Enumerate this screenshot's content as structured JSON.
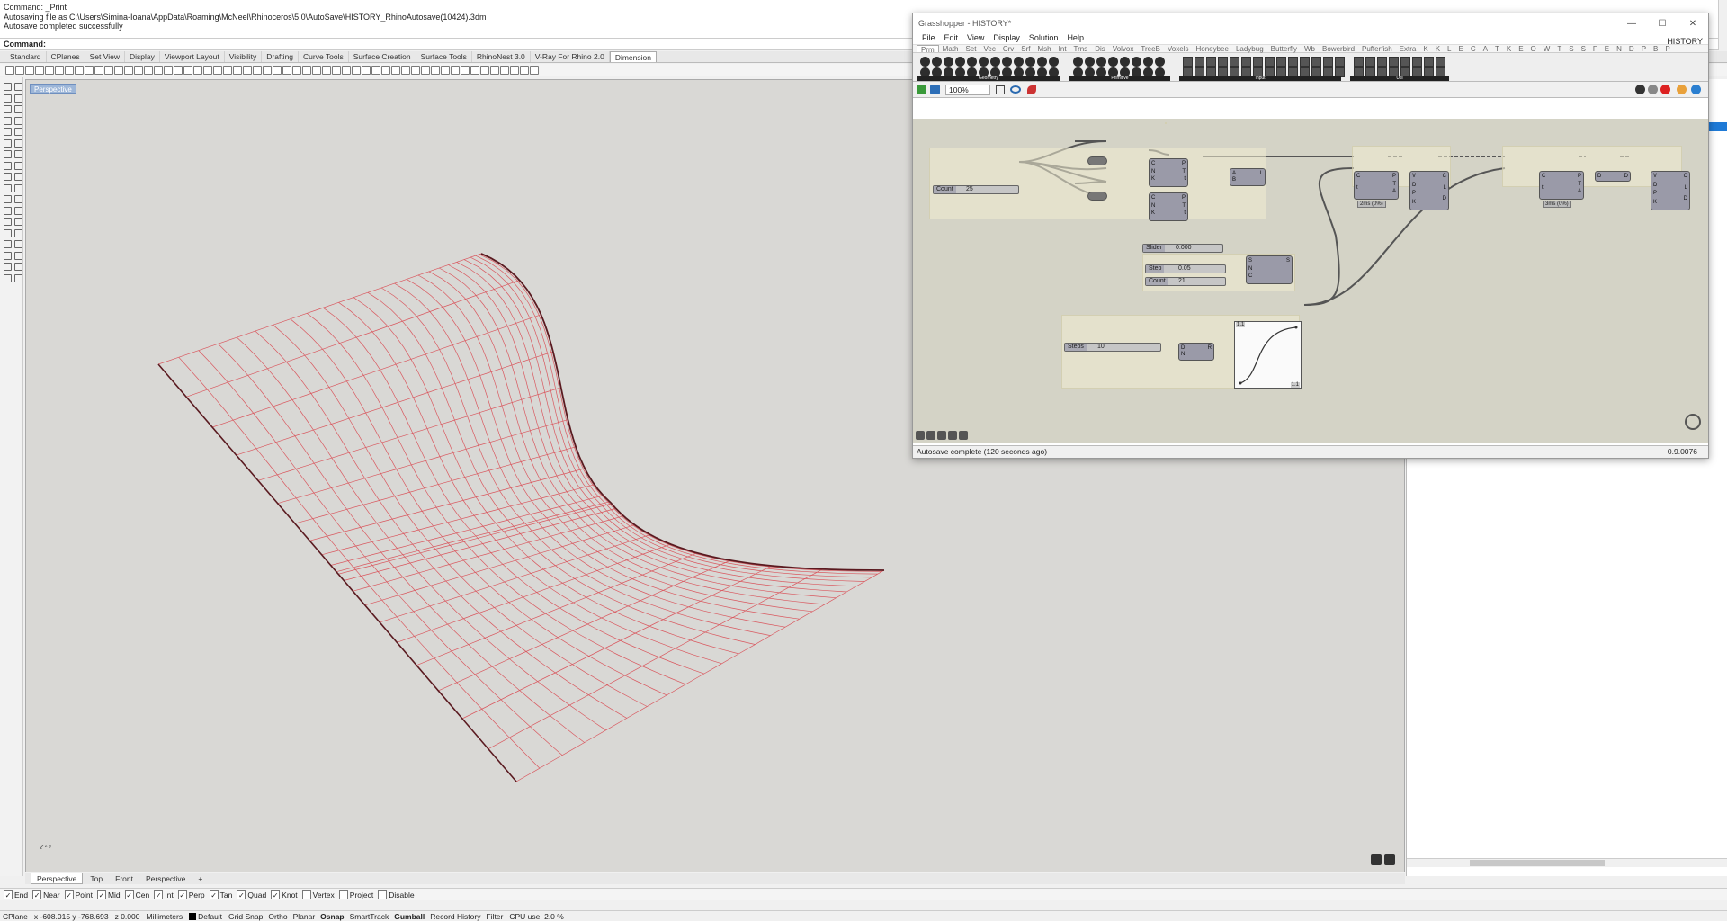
{
  "command_history": [
    "Command: _Print",
    "Autosaving file as C:\\Users\\Simina-Ioana\\AppData\\Roaming\\McNeel\\Rhinoceros\\5.0\\AutoSave\\HISTORY_RhinoAutosave(10424).3dm",
    "Autosave completed successfully"
  ],
  "command_prompt": "Command:",
  "toolbar_tabs": [
    "Standard",
    "CPlanes",
    "Set View",
    "Display",
    "Viewport Layout",
    "Visibility",
    "Drafting",
    "Curve Tools",
    "Surface Creation",
    "Surface Tools",
    "RhinoNest 3.0",
    "V-Ray For Rhino 2.0",
    "Dimension"
  ],
  "active_toolbar_tab": "Dimension",
  "viewport": {
    "title": "Perspective",
    "background": "#d9d8d5",
    "curve_color": "#d9585f",
    "edge_color": "#5a1a20"
  },
  "viewport_tabs": [
    "Perspective",
    "Top",
    "Front",
    "Perspective",
    "+"
  ],
  "active_viewport_tab": "Perspective",
  "osnaps": [
    {
      "label": "End",
      "checked": true
    },
    {
      "label": "Near",
      "checked": true
    },
    {
      "label": "Point",
      "checked": true
    },
    {
      "label": "Mid",
      "checked": true
    },
    {
      "label": "Cen",
      "checked": true
    },
    {
      "label": "Int",
      "checked": true
    },
    {
      "label": "Perp",
      "checked": true
    },
    {
      "label": "Tan",
      "checked": true
    },
    {
      "label": "Quad",
      "checked": true
    },
    {
      "label": "Knot",
      "checked": true
    },
    {
      "label": "Vertex",
      "checked": false
    },
    {
      "label": "Project",
      "checked": false
    },
    {
      "label": "Disable",
      "checked": false
    }
  ],
  "status": {
    "cplane": "CPlane",
    "coords": "x -608.015  y -768.693",
    "z": "z 0.000",
    "units": "Millimeters",
    "layer": "Default",
    "toggles": [
      "Grid Snap",
      "Ortho",
      "Planar",
      "Osnap",
      "SmartTrack",
      "Gumball",
      "Record History",
      "Filter"
    ],
    "bold_toggles": [
      "Osnap",
      "Gumball"
    ],
    "cpu": "CPU use: 2.0 %"
  },
  "grasshopper": {
    "window_title": "Grasshopper - HISTORY*",
    "menu": [
      "File",
      "Edit",
      "View",
      "Display",
      "Solution",
      "Help"
    ],
    "document_name": "HISTORY",
    "tabs": [
      "Prm",
      "Math",
      "Set",
      "Vec",
      "Crv",
      "Srf",
      "Msh",
      "Int",
      "Trns",
      "Dis",
      "Volvox",
      "TreeB",
      "Voxels",
      "Honeybee",
      "Ladybug",
      "Butterfly",
      "Wb",
      "Bowerbird",
      "Pufferfish",
      "Extra",
      "K",
      "K",
      "L",
      "E",
      "C",
      "A",
      "T",
      "K",
      "E",
      "O",
      "W",
      "T",
      "S",
      "S",
      "F",
      "E",
      "N",
      "D",
      "P",
      "B",
      "P"
    ],
    "active_tab": "Prm",
    "categories": [
      "Geometry",
      "Primitive",
      "Input",
      "Util"
    ],
    "zoom": "100%",
    "status": "Autosave complete (120 seconds ago)",
    "version": "0.9.0076",
    "sliders": [
      {
        "label": "Count",
        "value": "25"
      },
      {
        "label": "Slider",
        "value": "0.000"
      },
      {
        "label": "Step",
        "value": "0.05"
      },
      {
        "label": "Count",
        "value": "21"
      },
      {
        "label": "Steps",
        "value": "10"
      }
    ],
    "timers": [
      "2ms (0%)",
      "3ms (0%)"
    ],
    "node_ports": {
      "divide_a": {
        "in": [
          "C",
          "N",
          "K"
        ],
        "out": [
          "P",
          "T",
          "t"
        ]
      },
      "divide_b": {
        "in": [
          "C",
          "N",
          "K"
        ],
        "out": [
          "P",
          "T",
          "t"
        ]
      },
      "merge": {
        "in": [
          "A",
          "B"
        ],
        "out": [
          "L"
        ]
      },
      "loft_1": {
        "in": [
          "C",
          "t"
        ],
        "out": [
          "P",
          "T",
          "A"
        ]
      },
      "vec_1": {
        "in": [
          "V",
          "D",
          "P",
          "K"
        ],
        "out": [
          "C",
          "L",
          "D"
        ]
      },
      "series": {
        "in": [
          "S",
          "N",
          "C"
        ],
        "out": [
          "S"
        ]
      },
      "range": {
        "in": [
          "D",
          "N"
        ],
        "out": [
          "R"
        ]
      },
      "loft_2": {
        "in": [
          "C",
          "t"
        ],
        "out": [
          "P",
          "T",
          "A"
        ]
      },
      "dup": {
        "in": [
          "D"
        ],
        "out": [
          "D"
        ]
      },
      "vec_2": {
        "in": [
          "V",
          "D",
          "P",
          "K"
        ],
        "out": [
          "C",
          "L",
          "D"
        ]
      }
    },
    "graph_labels": {
      "top": "1.1",
      "bottom": "1.1"
    }
  }
}
